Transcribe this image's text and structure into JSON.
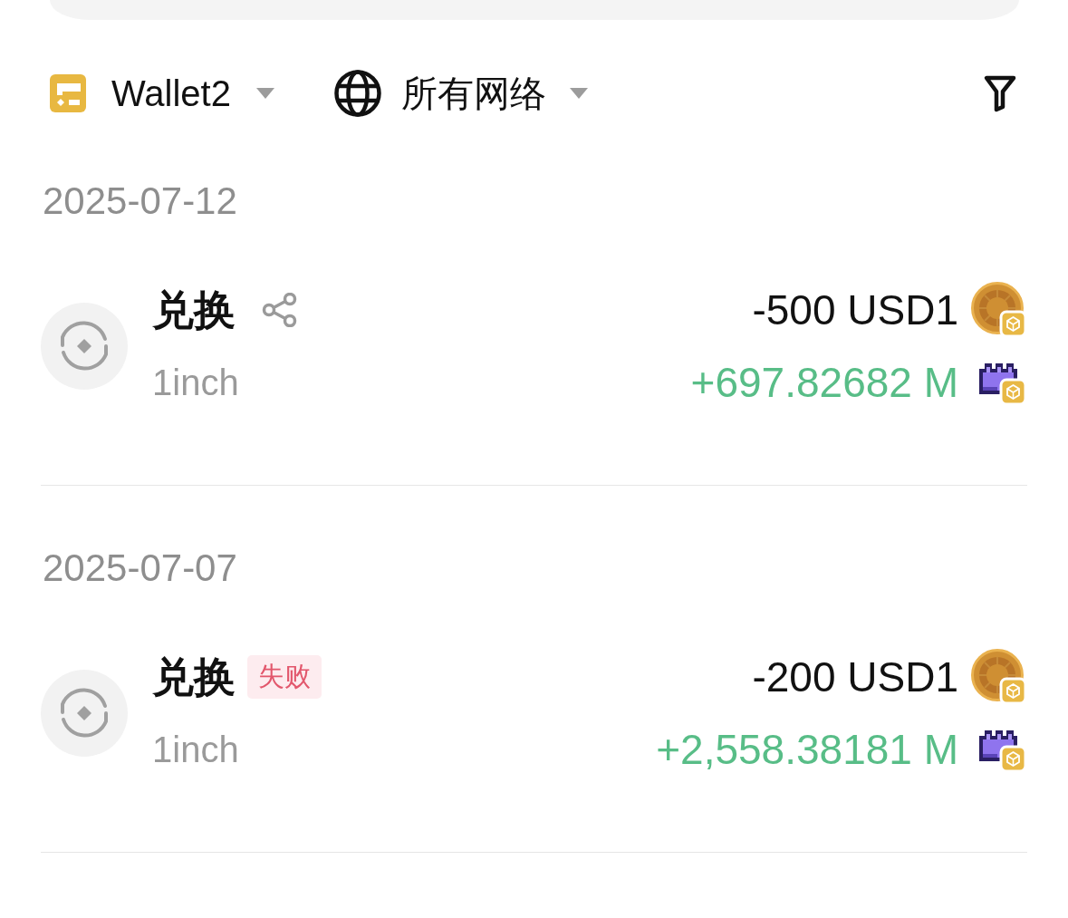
{
  "filters": [
    {
      "kind": "wallet",
      "label": "Wallet2"
    },
    {
      "kind": "network",
      "label": "所有网络"
    }
  ],
  "groups": [
    {
      "date": "2025-07-12",
      "transactions": [
        {
          "title": "兑换",
          "shareable": true,
          "subtitle": "1inch",
          "amounts": [
            {
              "kind": "sent",
              "text": "-500 USD1"
            },
            {
              "kind": "received",
              "text": "+697.82682 M"
            }
          ]
        }
      ]
    },
    {
      "date": "2025-07-07",
      "transactions": [
        {
          "title": "兑换",
          "shareable": false,
          "status": {
            "kind": "failed",
            "label": "失败"
          },
          "subtitle": "1inch",
          "amounts": [
            {
              "kind": "sent",
              "text": "-200 USD1"
            },
            {
              "kind": "received",
              "text": "+2,558.38181 M"
            }
          ]
        }
      ]
    }
  ]
}
